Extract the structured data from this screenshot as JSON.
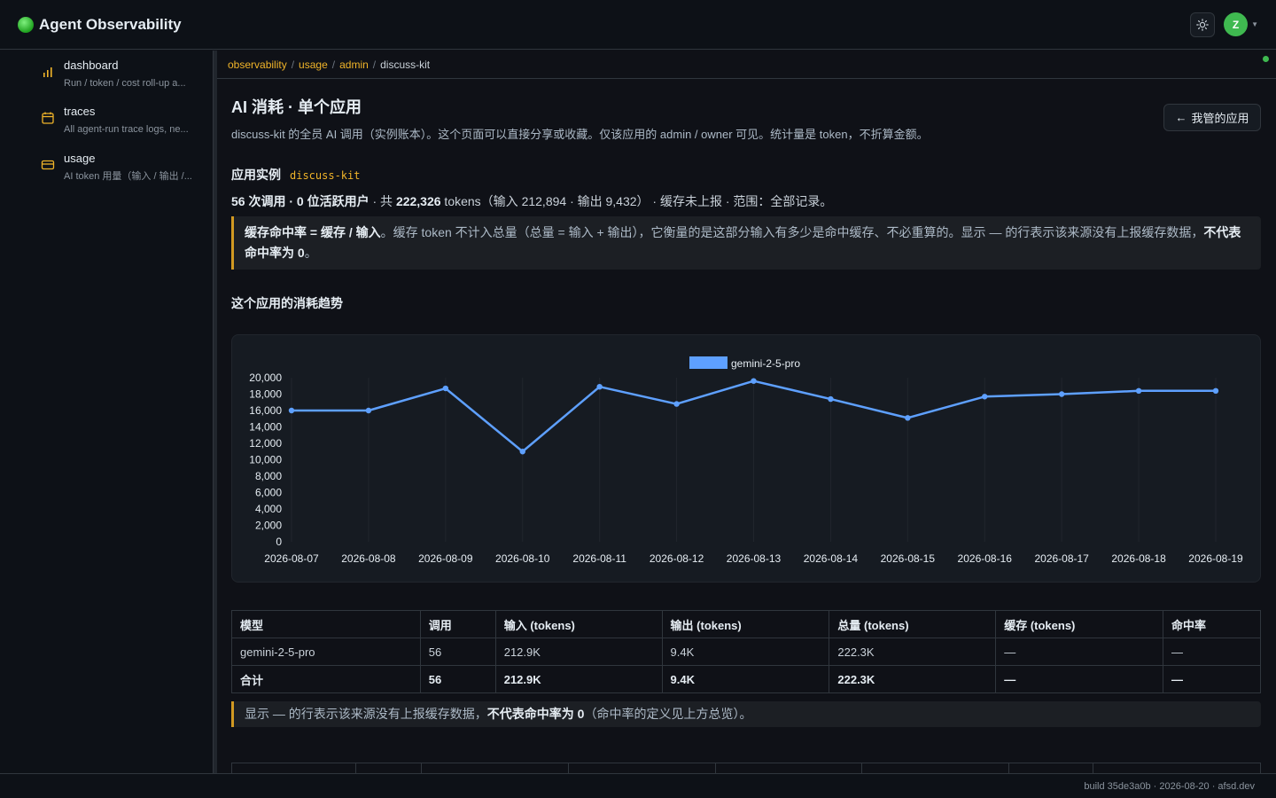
{
  "app": {
    "title": "Agent Observability",
    "avatar_initial": "Z"
  },
  "sidebar": {
    "items": [
      {
        "title": "dashboard",
        "subtitle": "Run / token / cost roll-up a..."
      },
      {
        "title": "traces",
        "subtitle": "All agent-run trace logs, ne..."
      },
      {
        "title": "usage",
        "subtitle": "AI token 用量（输入 / 输出 /..."
      }
    ]
  },
  "breadcrumb": {
    "items": [
      "observability",
      "usage",
      "admin"
    ],
    "current": "discuss-kit"
  },
  "page": {
    "title": "AI 消耗 · 单个应用",
    "description": "discuss-kit 的全员 AI 调用（实例账本）。这个页面可以直接分享或收藏。仅该应用的 admin / owner 可见。统计量是 token，不折算金额。",
    "back_button": "我管的应用",
    "instance_label": "应用实例",
    "instance_code": "discuss-kit",
    "summary_bold": "56 次调用 · 0 位活跃用户",
    "summary_mid": " · 共 ",
    "summary_tokens": "222,326",
    "summary_rest": " tokens（输入 212,894 · 输出 9,432） · 缓存未上报 · 范围：全部记录。",
    "callout1_bold": "缓存命中率 = 缓存 / 输入",
    "callout1_text": "。缓存 token 不计入总量（总量 = 输入 + 输出），它衡量的是这部分输入有多少是命中缓存、不必重算的。显示 — 的行表示该来源没有上报缓存数据，",
    "callout1_bold2": "不代表命中率为 0",
    "callout1_end": "。",
    "trend_title": "这个应用的消耗趋势",
    "callout2_text": "显示 — 的行表示该来源没有上报缓存数据，",
    "callout2_bold": "不代表命中率为 0",
    "callout2_end": "（命中率的定义见上方总览）。"
  },
  "chart_data": {
    "type": "line",
    "x": [
      "2026-08-07",
      "2026-08-08",
      "2026-08-09",
      "2026-08-10",
      "2026-08-11",
      "2026-08-12",
      "2026-08-13",
      "2026-08-14",
      "2026-08-15",
      "2026-08-16",
      "2026-08-17",
      "2026-08-18",
      "2026-08-19"
    ],
    "series": [
      {
        "name": "gemini-2-5-pro",
        "values": [
          16000,
          16000,
          18700,
          11000,
          18900,
          16800,
          19600,
          17400,
          15100,
          17700,
          18000,
          18400,
          18400
        ],
        "color": "#5ea0ff"
      }
    ],
    "ylim": [
      0,
      20000
    ],
    "yticks": [
      0,
      2000,
      4000,
      6000,
      8000,
      10000,
      12000,
      14000,
      16000,
      18000,
      20000
    ],
    "ytick_labels": [
      "0",
      "2,000",
      "4,000",
      "6,000",
      "8,000",
      "10,000",
      "12,000",
      "14,000",
      "16,000",
      "18,000",
      "20,000"
    ],
    "legend": "top-center",
    "grid": true
  },
  "table": {
    "headers": [
      "模型",
      "调用",
      "输入 (tokens)",
      "输出 (tokens)",
      "总量 (tokens)",
      "缓存 (tokens)",
      "命中率"
    ],
    "rows": [
      [
        "gemini-2-5-pro",
        "56",
        "212.9K",
        "9.4K",
        "222.3K",
        "—",
        "—"
      ]
    ],
    "total": [
      "合计",
      "56",
      "212.9K",
      "9.4K",
      "222.3K",
      "—",
      "—"
    ]
  },
  "footer": {
    "text": "build 35de3a0b · 2026-08-20 · afsd.dev"
  },
  "colors": {
    "accent": "#f0b429",
    "line": "#5ea0ff",
    "background": "#0f1117"
  }
}
